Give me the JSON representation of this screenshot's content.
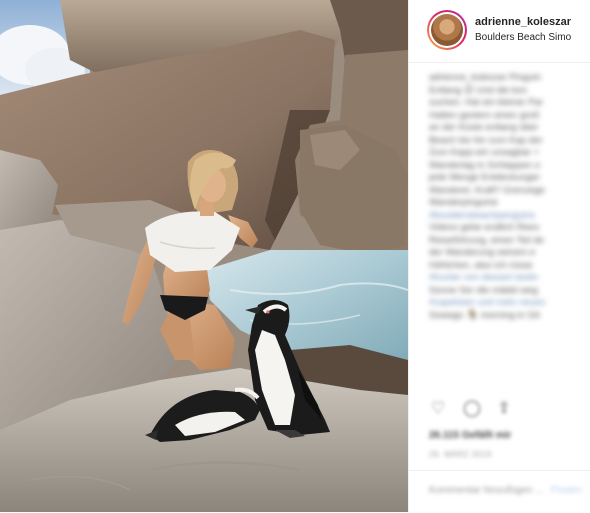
{
  "post": {
    "username": "adrienne_koleszar",
    "location": "Boulders Beach Simo",
    "caption_lines": [
      {
        "text": "adrienne_koleszar Pinguin",
        "tag": false
      },
      {
        "text": "Entlang 😊 Und die kon",
        "tag": false
      },
      {
        "text": "suchen. Hat ein kleiner Par",
        "tag": false
      },
      {
        "text": "Hatten gestern einen groß",
        "tag": false
      },
      {
        "text": "an der Küste entlang über",
        "tag": false
      },
      {
        "text": "Beach bis hin zum Kap der",
        "tag": false
      },
      {
        "text": "Zum Kapp-ein unsagbar +",
        "tag": false
      },
      {
        "text": "Wanderlag in Schlappen o",
        "tag": false
      },
      {
        "text": "jede Menge Entdeckunger",
        "tag": false
      },
      {
        "text": "Wanderer, Kraft? Grenzege",
        "tag": false
      },
      {
        "text": "Wanderpinguine",
        "tag": false
      },
      {
        "text": "#bouldersbeachpenguins",
        "tag": true
      },
      {
        "text": "Videos gebe endlich Rees",
        "tag": false
      },
      {
        "text": "Reiseführung, einen Teil de",
        "tag": false
      },
      {
        "text": "der Wanderung seinem e",
        "tag": false
      },
      {
        "text": "Höhlchen, also ich rüsse",
        "tag": false
      },
      {
        "text": "#hunter von dessert testin",
        "tag": true
      },
      {
        "text": "Sonne Ser die mädel weg",
        "tag": false
      },
      {
        "text": "#capetown und mein neues",
        "tag": true
      },
      {
        "text": "Sowego 🐧 morning in SA",
        "tag": false
      }
    ],
    "icons": {
      "like": "heart-icon",
      "comment": "comment-icon",
      "share": "share-icon"
    },
    "likes_text": "26.115 Gefällt mir",
    "date_text": "26. MÄRZ 2019",
    "comment_placeholder": "Kommentar hinzufügen ...",
    "post_button": "Posten"
  },
  "colors": {
    "accent": "#3897f0",
    "border": "#efefef",
    "text": "#262626"
  }
}
